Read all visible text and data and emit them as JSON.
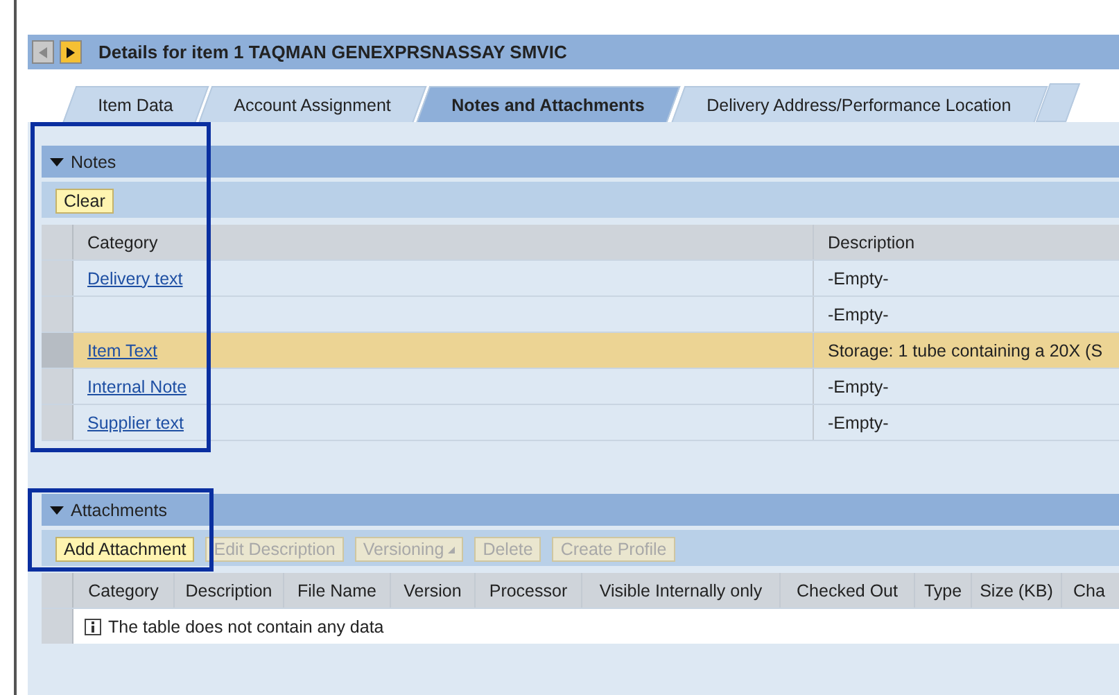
{
  "header": {
    "title": "Details for item 1  TAQMAN GENEXPRSNASSAY SMVIC",
    "prev_disabled": true
  },
  "tabs": [
    {
      "label": "Item Data",
      "selected": false
    },
    {
      "label": "Account Assignment",
      "selected": false
    },
    {
      "label": "Notes and Attachments",
      "selected": true
    },
    {
      "label": "Delivery Address/Performance Location",
      "selected": false
    }
  ],
  "notes": {
    "title": "Notes",
    "expanded": true,
    "buttons": [
      {
        "label": "Clear",
        "disabled": false
      }
    ],
    "columns": [
      "Category",
      "Description"
    ],
    "rows": [
      {
        "category": "Delivery text",
        "description": "-Empty-",
        "selected": false
      },
      {
        "description": "-Empty-",
        "selected": false
      },
      {
        "category": "Item Text",
        "description": "Storage: 1 tube containing a 20X (S",
        "selected": true
      },
      {
        "category": "Internal Note",
        "description": "-Empty-",
        "selected": false
      },
      {
        "category": "Supplier text",
        "description": "-Empty-",
        "selected": false
      }
    ]
  },
  "attachments": {
    "title": "Attachments",
    "expanded": true,
    "buttons": [
      {
        "label": "Add Attachment",
        "disabled": false
      },
      {
        "label": "Edit Description",
        "disabled": true
      },
      {
        "label": "Versioning",
        "disabled": true,
        "menu": true
      },
      {
        "label": "Delete",
        "disabled": true
      },
      {
        "label": "Create Profile",
        "disabled": true
      }
    ],
    "columns": [
      "Category",
      "Description",
      "File Name",
      "Version",
      "Processor",
      "Visible Internally only",
      "Checked Out",
      "Type",
      "Size (KB)",
      "Cha"
    ],
    "empty_message": "The table does not contain any data"
  }
}
